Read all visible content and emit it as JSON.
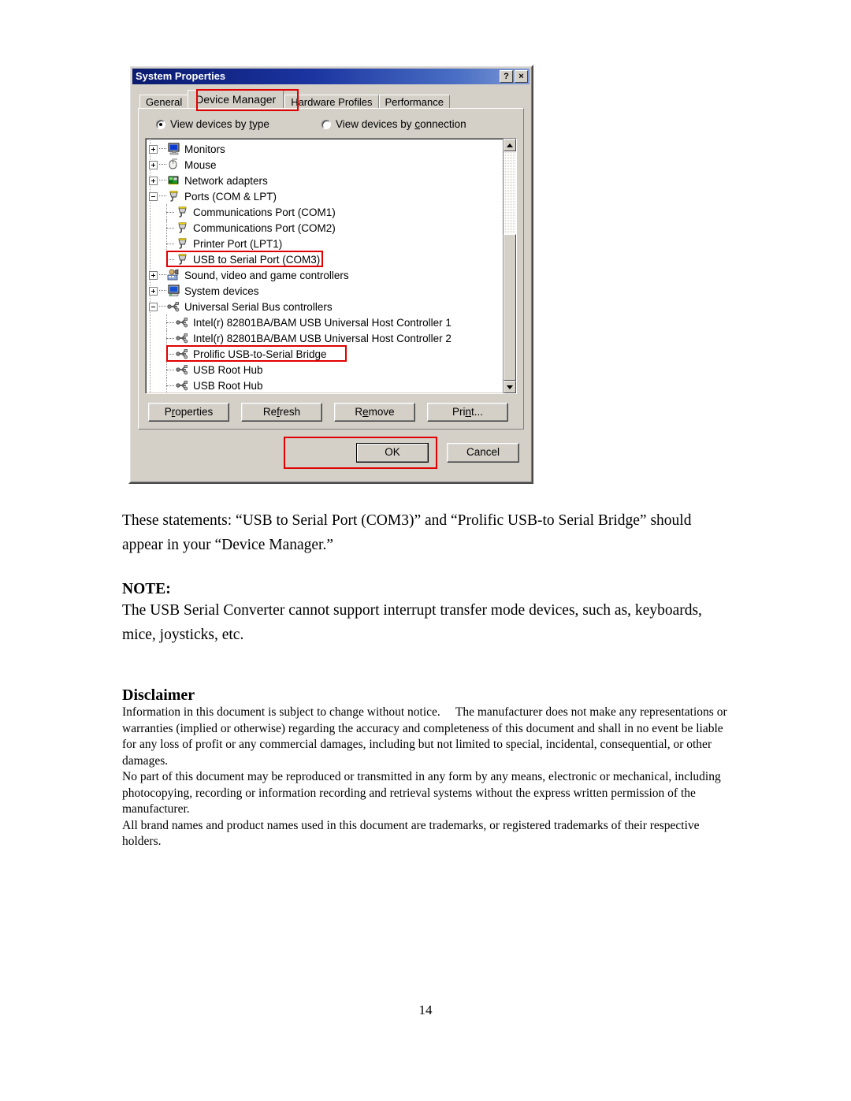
{
  "dialog": {
    "title": "System Properties",
    "title_buttons": [
      {
        "name": "help-button",
        "label": "?"
      },
      {
        "name": "close-button",
        "label": "×"
      }
    ],
    "tabs": [
      {
        "label": "General",
        "active": false
      },
      {
        "label": "Device Manager",
        "active": true
      },
      {
        "label": "Hardware Profiles",
        "active": false
      },
      {
        "label": "Performance",
        "active": false
      }
    ],
    "view_options": [
      {
        "label_before": "View devices by ",
        "accel": "t",
        "label_after": "ype",
        "checked": true
      },
      {
        "label_before": "View devices by ",
        "accel": "c",
        "label_after": "onnection",
        "checked": false
      }
    ],
    "tree": [
      {
        "label": "Monitors",
        "level": 0,
        "expander": "plus",
        "icon": "monitor-icon"
      },
      {
        "label": "Mouse",
        "level": 0,
        "expander": "plus",
        "icon": "mouse-icon"
      },
      {
        "label": "Network adapters",
        "level": 0,
        "expander": "plus",
        "icon": "network-adapter-icon"
      },
      {
        "label": "Ports (COM & LPT)",
        "level": 0,
        "expander": "minus",
        "icon": "serial-port-icon"
      },
      {
        "label": "Communications Port (COM1)",
        "level": 1,
        "expander": "none",
        "icon": "serial-port-icon"
      },
      {
        "label": "Communications Port (COM2)",
        "level": 1,
        "expander": "none",
        "icon": "serial-port-icon"
      },
      {
        "label": "Printer Port (LPT1)",
        "level": 1,
        "expander": "none",
        "icon": "serial-port-icon"
      },
      {
        "label": "USB to Serial Port (COM3)",
        "level": 1,
        "expander": "none",
        "icon": "serial-port-icon",
        "highlighted": true
      },
      {
        "label": "Sound, video and game controllers",
        "level": 0,
        "expander": "plus",
        "icon": "sound-controller-icon"
      },
      {
        "label": "System devices",
        "level": 0,
        "expander": "plus",
        "icon": "system-device-icon"
      },
      {
        "label": "Universal Serial Bus controllers",
        "level": 0,
        "expander": "minus",
        "icon": "usb-icon"
      },
      {
        "label": "Intel(r) 82801BA/BAM USB Universal Host Controller 1",
        "level": 1,
        "expander": "none",
        "icon": "usb-icon"
      },
      {
        "label": "Intel(r) 82801BA/BAM USB Universal Host Controller 2",
        "level": 1,
        "expander": "none",
        "icon": "usb-icon"
      },
      {
        "label": "Prolific USB-to-Serial Bridge",
        "level": 1,
        "expander": "none",
        "icon": "usb-icon",
        "highlighted": true
      },
      {
        "label": "USB Root Hub",
        "level": 1,
        "expander": "none",
        "icon": "usb-icon"
      },
      {
        "label": "USB Root Hub",
        "level": 1,
        "expander": "none",
        "icon": "usb-icon"
      }
    ],
    "action_buttons": [
      {
        "name": "properties-button",
        "before": "P",
        "accel": "r",
        "after": "operties"
      },
      {
        "name": "refresh-button",
        "before": "Re",
        "accel": "f",
        "after": "resh"
      },
      {
        "name": "remove-button",
        "before": "R",
        "accel": "e",
        "after": "move"
      },
      {
        "name": "print-button",
        "before": "Pri",
        "accel": "n",
        "after": "t..."
      }
    ],
    "ok_label": "OK",
    "cancel_label": "Cancel",
    "highlight_color": "#e00000"
  },
  "document": {
    "intro": "These statements: “USB to Serial Port (COM3)” and “Prolific USB-to Serial Bridge” should appear in your “Device Manager.”",
    "note_heading": "NOTE:",
    "note_body": "The USB Serial Converter cannot support interrupt transfer mode devices, such as, keyboards, mice, joysticks, etc.",
    "disclaimer_heading": "Disclaimer",
    "disclaimer_paragraphs": [
      "Information in this document is subject to change without notice.  The manufacturer does not make any representations or warranties (implied or otherwise) regarding the accuracy and completeness of this document and shall in no event be liable for any loss of profit or any commercial damages, including but not limited to special, incidental, consequential, or other damages.",
      "No part of this document may be reproduced or transmitted in any form by any means, electronic or mechanical, including photocopying, recording or information recording and retrieval systems without the express written permission of the manufacturer.",
      "All brand names and product names used in this document are trademarks, or registered trademarks of their respective holders."
    ],
    "page_number": "14"
  }
}
